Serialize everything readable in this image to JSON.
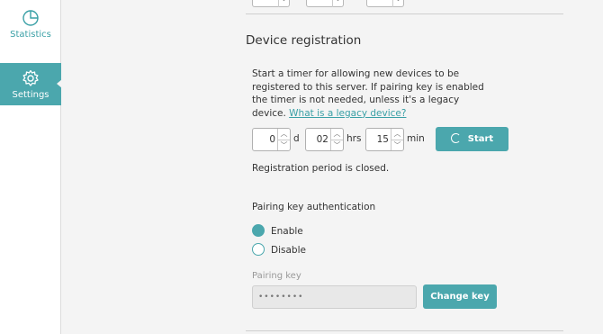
{
  "sidebar": {
    "items": [
      {
        "label": "Statistics",
        "icon": "pie-chart-icon",
        "active": false
      },
      {
        "label": "Settings",
        "icon": "gear-icon",
        "active": true
      }
    ]
  },
  "registration": {
    "title": "Device registration",
    "description": "Start a timer for allowing new devices to be registered to this server. If pairing key is enabled the timer is not needed, unless it's a legacy device. ",
    "legacy_link": "What is a legacy device?",
    "days_value": "0",
    "days_unit": "d",
    "hours_value": "02",
    "hours_unit": "hrs",
    "minutes_value": "15",
    "minutes_unit": "min",
    "start_label": "Start",
    "status": "Registration period is closed."
  },
  "pairing": {
    "heading": "Pairing key authentication",
    "enable_label": "Enable",
    "disable_label": "Disable",
    "selected": "Enable",
    "key_label": "Pairing key",
    "key_value": "••••••••",
    "change_label": "Change key"
  },
  "colors": {
    "accent": "#4ba7ad",
    "link": "#3aa0a6"
  }
}
